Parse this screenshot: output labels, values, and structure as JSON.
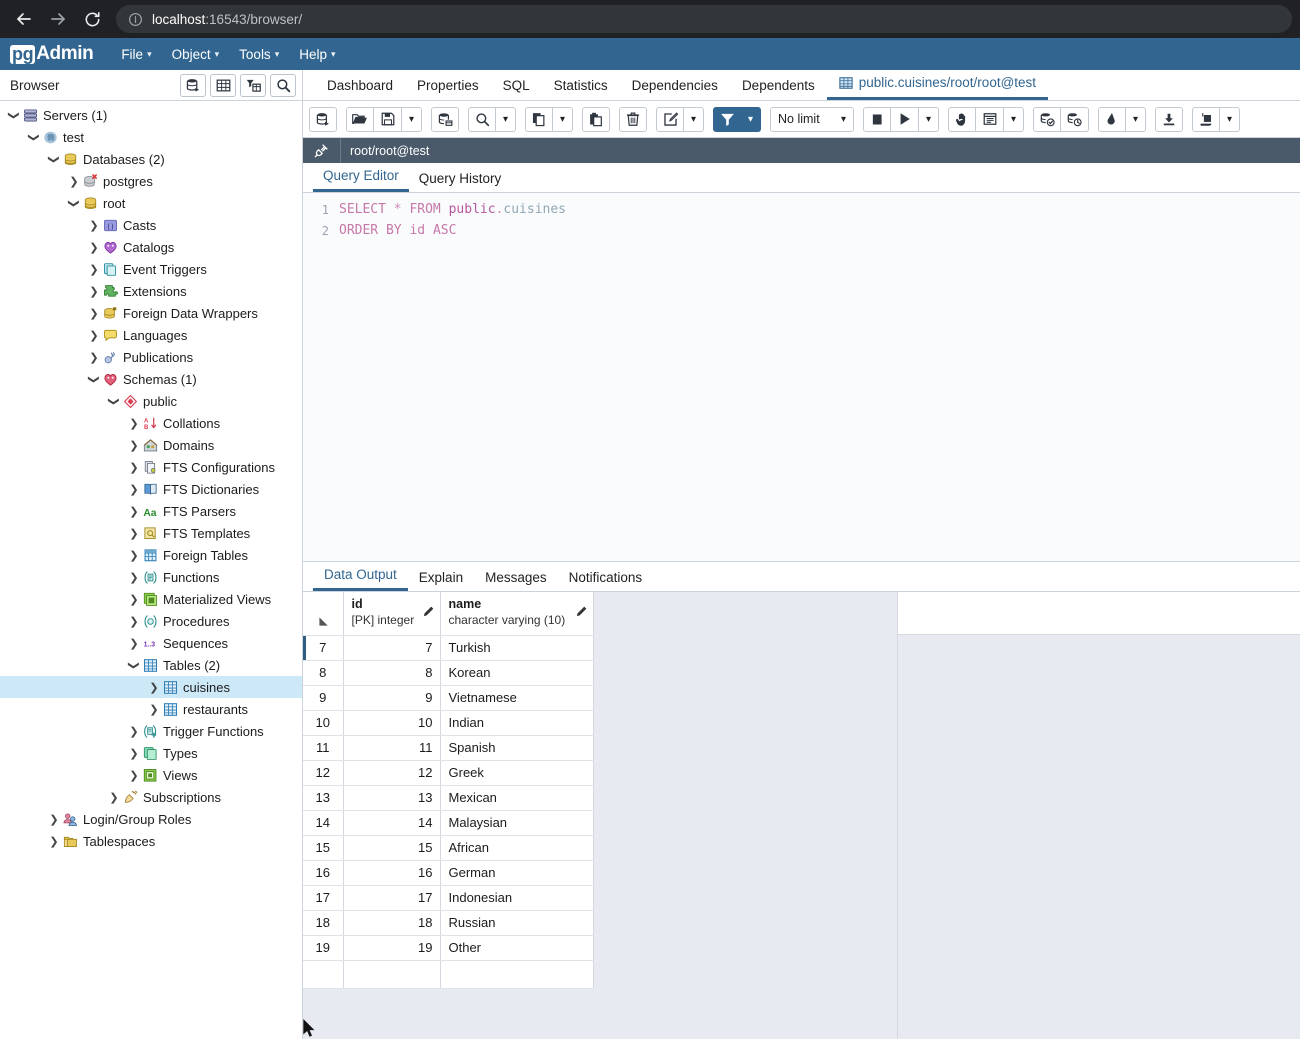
{
  "browser_chrome": {
    "back_label": "back",
    "forward_label": "forward",
    "reload_label": "reload",
    "url_host": "localhost",
    "url_rest": ":16543/browser/"
  },
  "menubar": {
    "logo_mark": "pg",
    "logo_text": "Admin",
    "items": [
      {
        "label": "File"
      },
      {
        "label": "Object"
      },
      {
        "label": "Tools"
      },
      {
        "label": "Help"
      }
    ]
  },
  "browser_panel": {
    "title": "Browser",
    "toolbar": [
      {
        "name": "query-tool-button"
      },
      {
        "name": "view-data-button"
      },
      {
        "name": "filtered-rows-button"
      },
      {
        "name": "search-objects-button"
      }
    ],
    "tree": [
      {
        "label": "Servers (1)",
        "indent": 0,
        "state": "open",
        "icon": "servers"
      },
      {
        "label": "test",
        "indent": 1,
        "state": "open",
        "icon": "server"
      },
      {
        "label": "Databases (2)",
        "indent": 2,
        "state": "open",
        "icon": "databases"
      },
      {
        "label": "postgres",
        "indent": 3,
        "state": "closed",
        "icon": "database-disconnected"
      },
      {
        "label": "root",
        "indent": 3,
        "state": "open",
        "icon": "database"
      },
      {
        "label": "Casts",
        "indent": 4,
        "state": "closed",
        "icon": "casts"
      },
      {
        "label": "Catalogs",
        "indent": 4,
        "state": "closed",
        "icon": "catalogs"
      },
      {
        "label": "Event Triggers",
        "indent": 4,
        "state": "closed",
        "icon": "event-triggers"
      },
      {
        "label": "Extensions",
        "indent": 4,
        "state": "closed",
        "icon": "extensions"
      },
      {
        "label": "Foreign Data Wrappers",
        "indent": 4,
        "state": "closed",
        "icon": "foreign-data-wrappers"
      },
      {
        "label": "Languages",
        "indent": 4,
        "state": "closed",
        "icon": "languages"
      },
      {
        "label": "Publications",
        "indent": 4,
        "state": "closed",
        "icon": "publications"
      },
      {
        "label": "Schemas (1)",
        "indent": 4,
        "state": "open",
        "icon": "schemas"
      },
      {
        "label": "public",
        "indent": 5,
        "state": "open",
        "icon": "schema"
      },
      {
        "label": "Collations",
        "indent": 6,
        "state": "closed",
        "icon": "collations"
      },
      {
        "label": "Domains",
        "indent": 6,
        "state": "closed",
        "icon": "domains"
      },
      {
        "label": "FTS Configurations",
        "indent": 6,
        "state": "closed",
        "icon": "fts-configurations"
      },
      {
        "label": "FTS Dictionaries",
        "indent": 6,
        "state": "closed",
        "icon": "fts-dictionaries"
      },
      {
        "label": "FTS Parsers",
        "indent": 6,
        "state": "closed",
        "icon": "fts-parsers"
      },
      {
        "label": "FTS Templates",
        "indent": 6,
        "state": "closed",
        "icon": "fts-templates"
      },
      {
        "label": "Foreign Tables",
        "indent": 6,
        "state": "closed",
        "icon": "foreign-tables"
      },
      {
        "label": "Functions",
        "indent": 6,
        "state": "closed",
        "icon": "functions"
      },
      {
        "label": "Materialized Views",
        "indent": 6,
        "state": "closed",
        "icon": "materialized-views"
      },
      {
        "label": "Procedures",
        "indent": 6,
        "state": "closed",
        "icon": "procedures"
      },
      {
        "label": "Sequences",
        "indent": 6,
        "state": "closed",
        "icon": "sequences"
      },
      {
        "label": "Tables (2)",
        "indent": 6,
        "state": "open",
        "icon": "tables"
      },
      {
        "label": "cuisines",
        "indent": 7,
        "state": "closed",
        "icon": "table",
        "selected": true
      },
      {
        "label": "restaurants",
        "indent": 7,
        "state": "closed",
        "icon": "table"
      },
      {
        "label": "Trigger Functions",
        "indent": 6,
        "state": "closed",
        "icon": "trigger-functions"
      },
      {
        "label": "Types",
        "indent": 6,
        "state": "closed",
        "icon": "types"
      },
      {
        "label": "Views",
        "indent": 6,
        "state": "closed",
        "icon": "views"
      },
      {
        "label": "Subscriptions",
        "indent": 5,
        "state": "closed",
        "icon": "subscriptions"
      },
      {
        "label": "Login/Group Roles",
        "indent": 2,
        "state": "closed",
        "icon": "roles"
      },
      {
        "label": "Tablespaces",
        "indent": 2,
        "state": "closed",
        "icon": "tablespaces"
      }
    ]
  },
  "object_tabs": [
    {
      "label": "Dashboard",
      "active": false
    },
    {
      "label": "Properties",
      "active": false
    },
    {
      "label": "SQL",
      "active": false
    },
    {
      "label": "Statistics",
      "active": false
    },
    {
      "label": "Dependencies",
      "active": false
    },
    {
      "label": "Dependents",
      "active": false
    },
    {
      "label": "public.cuisines/root/root@test",
      "active": true,
      "icon": "grid-icon"
    }
  ],
  "query_toolbar": {
    "limit_value": "No limit",
    "buttons": [
      {
        "name": "open-query-tool",
        "icon": "query-tool-icon"
      },
      {
        "name": "open-file",
        "icon": "folder-open-icon"
      },
      {
        "name": "save-file",
        "icon": "save-icon"
      },
      {
        "name": "save-file-dropdown",
        "icon": "chevron-down-icon"
      },
      {
        "name": "show-query-tool",
        "icon": "db-query-icon"
      },
      {
        "name": "find",
        "icon": "search-icon"
      },
      {
        "name": "find-dropdown",
        "icon": "chevron-down-icon"
      },
      {
        "name": "copy",
        "icon": "copy-icon"
      },
      {
        "name": "copy-dropdown",
        "icon": "chevron-down-icon"
      },
      {
        "name": "paste",
        "icon": "paste-icon"
      },
      {
        "name": "delete-row",
        "icon": "trash-icon"
      },
      {
        "name": "edit-options",
        "icon": "edit-icon"
      },
      {
        "name": "edit-options-dropdown",
        "icon": "chevron-down-icon"
      },
      {
        "name": "filter",
        "icon": "filter-icon",
        "active": true
      },
      {
        "name": "filter-dropdown",
        "icon": "chevron-down-icon",
        "active": true
      },
      {
        "name": "stop-query",
        "icon": "stop-icon"
      },
      {
        "name": "execute-query",
        "icon": "play-icon"
      },
      {
        "name": "execute-dropdown",
        "icon": "chevron-down-icon"
      },
      {
        "name": "macros",
        "icon": "hand-icon"
      },
      {
        "name": "explain-options",
        "icon": "list-icon"
      },
      {
        "name": "explain-dropdown",
        "icon": "chevron-down-icon"
      },
      {
        "name": "commit",
        "icon": "commit-icon"
      },
      {
        "name": "rollback",
        "icon": "rollback-icon"
      },
      {
        "name": "clear",
        "icon": "eraser-icon"
      },
      {
        "name": "clear-dropdown",
        "icon": "chevron-down-icon"
      },
      {
        "name": "download-csv",
        "icon": "download-icon"
      },
      {
        "name": "macro-manager",
        "icon": "macro-icon"
      },
      {
        "name": "macro-dropdown",
        "icon": "chevron-down-icon"
      }
    ]
  },
  "connection_bar": {
    "icon": "connection-icon",
    "text": "root/root@test"
  },
  "query_tabs": [
    {
      "label": "Query Editor",
      "active": true
    },
    {
      "label": "Query History",
      "active": false
    }
  ],
  "editor": {
    "lines": [
      {
        "number": "1",
        "tokens": [
          {
            "text": "SELECT",
            "type": "kw"
          },
          {
            "text": " ",
            "type": "plain"
          },
          {
            "text": "*",
            "type": "op"
          },
          {
            "text": " ",
            "type": "plain"
          },
          {
            "text": "FROM",
            "type": "kw"
          },
          {
            "text": " ",
            "type": "plain"
          },
          {
            "text": "public",
            "type": "sch"
          },
          {
            "text": ".",
            "type": "op"
          },
          {
            "text": "cuisines",
            "type": "tbl"
          }
        ]
      },
      {
        "number": "2",
        "tokens": [
          {
            "text": "ORDER",
            "type": "kw"
          },
          {
            "text": " ",
            "type": "plain"
          },
          {
            "text": "BY",
            "type": "kw"
          },
          {
            "text": " ",
            "type": "plain"
          },
          {
            "text": "id",
            "type": "kw"
          },
          {
            "text": " ",
            "type": "plain"
          },
          {
            "text": "ASC",
            "type": "kw"
          }
        ]
      }
    ]
  },
  "result_tabs": [
    {
      "label": "Data Output",
      "active": true
    },
    {
      "label": "Explain",
      "active": false
    },
    {
      "label": "Messages",
      "active": false
    },
    {
      "label": "Notifications",
      "active": false
    }
  ],
  "data_grid": {
    "columns": [
      {
        "name": "id",
        "type": "[PK] integer",
        "width": 97
      },
      {
        "name": "name",
        "type": "character varying (10)",
        "width": 153
      }
    ],
    "rows": [
      {
        "rownum": "7",
        "id": "7",
        "name": "Turkish"
      },
      {
        "rownum": "8",
        "id": "8",
        "name": "Korean"
      },
      {
        "rownum": "9",
        "id": "9",
        "name": "Vietnamese"
      },
      {
        "rownum": "10",
        "id": "10",
        "name": "Indian"
      },
      {
        "rownum": "11",
        "id": "11",
        "name": "Spanish"
      },
      {
        "rownum": "12",
        "id": "12",
        "name": "Greek"
      },
      {
        "rownum": "13",
        "id": "13",
        "name": "Mexican"
      },
      {
        "rownum": "14",
        "id": "14",
        "name": "Malaysian"
      },
      {
        "rownum": "15",
        "id": "15",
        "name": "African"
      },
      {
        "rownum": "16",
        "id": "16",
        "name": "German"
      },
      {
        "rownum": "17",
        "id": "17",
        "name": "Indonesian"
      },
      {
        "rownum": "18",
        "id": "18",
        "name": "Russian"
      },
      {
        "rownum": "19",
        "id": "19",
        "name": "Other"
      }
    ]
  },
  "colors": {
    "brand": "#326690",
    "chrome_bg": "#202124",
    "connection_bar": "#4a5a6a",
    "selection": "#cde9f7",
    "grid_filler": "#e7eaf0"
  }
}
